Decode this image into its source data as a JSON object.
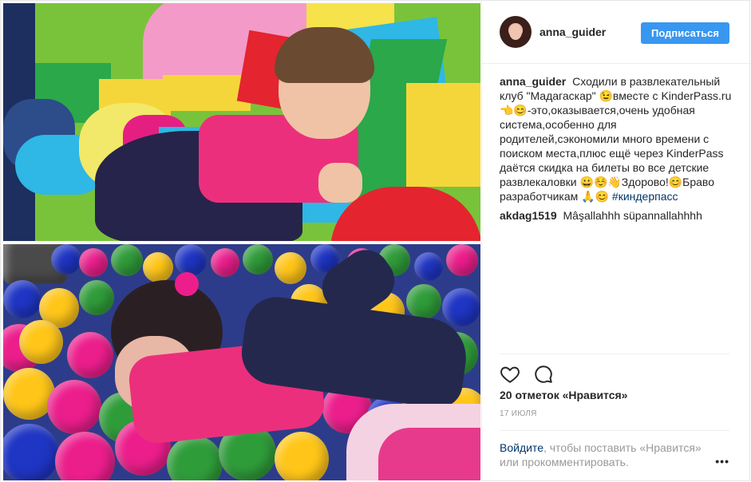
{
  "post": {
    "author": {
      "username": "anna_guider",
      "follow_label": "Подписаться"
    },
    "caption": {
      "username": "anna_guider",
      "text_before": "Сходили в развлекательный клуб \"Мадагаскар\" 😉вместе с KinderPass.ru 👈😊-это,оказывается,очень удобная система,особенно для родителей,сэкономили много времени с поиском места,плюс ещё через KinderPass даётся скидка на билеты во все детские развлекаловки 😀☺️👋Здорово!😊Браво разработчикам 🙏😊",
      "hashtag": "#киндерпасс"
    },
    "comments": [
      {
        "username": "akdag1519",
        "text": "Mâşallahhh süpannallahhhh"
      }
    ],
    "likes": "20 отметок «Нравится»",
    "date": "17 июля",
    "login_prompt": {
      "link": "Войдите",
      "rest": ", чтобы поставить «Нравится» или прокомментировать."
    },
    "more_label": "•••",
    "icons": {
      "like": "heart-icon",
      "comment": "speech-bubble-icon",
      "more": "ellipsis-icon"
    },
    "colors": {
      "follow_button": "#3897f0",
      "link": "#003569",
      "muted": "#999999"
    }
  }
}
